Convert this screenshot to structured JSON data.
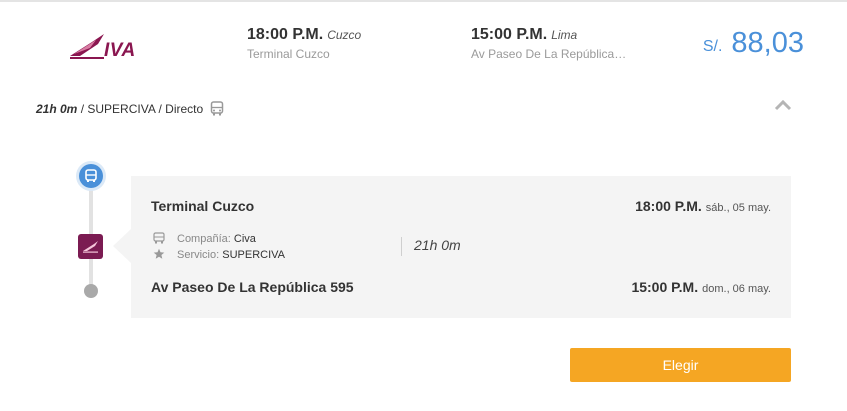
{
  "brand": {
    "name": "CIVA",
    "logo_text": "IVA",
    "color": "#8a1650"
  },
  "departure": {
    "time": "18:00 P.M.",
    "city": "Cuzco",
    "terminal": "Terminal Cuzco"
  },
  "arrival": {
    "time": "15:00 P.M.",
    "city": "Lima",
    "terminal": "Av Paseo De La República 5..."
  },
  "price": {
    "currency": "S/.",
    "amount": "88,03",
    "color": "#4a90d9"
  },
  "summary": {
    "duration": "21h 0m",
    "rest": " / SUPERCIVA / Directo",
    "icon": "bus-icon"
  },
  "collapse_icon": "chevron-up-icon",
  "details": {
    "origin": {
      "name": "Terminal Cuzco",
      "time": "18:00 P.M.",
      "date": "sáb., 05 may."
    },
    "company": {
      "label": "Compañía:",
      "value": "Civa",
      "icon": "bus-icon"
    },
    "service": {
      "label": "Servicio:",
      "value": "SUPERCIVA",
      "icon": "star-icon"
    },
    "duration": "21h 0m",
    "destination": {
      "name": "Av Paseo De La República 595",
      "time": "15:00 P.M.",
      "date": "dom., 06 may."
    }
  },
  "timeline": {
    "start_icon": "bus-icon",
    "mid_icon": "civa-logo-icon",
    "end_icon": "dot-icon"
  },
  "action": {
    "label": "Elegir",
    "color": "#f5a623"
  }
}
